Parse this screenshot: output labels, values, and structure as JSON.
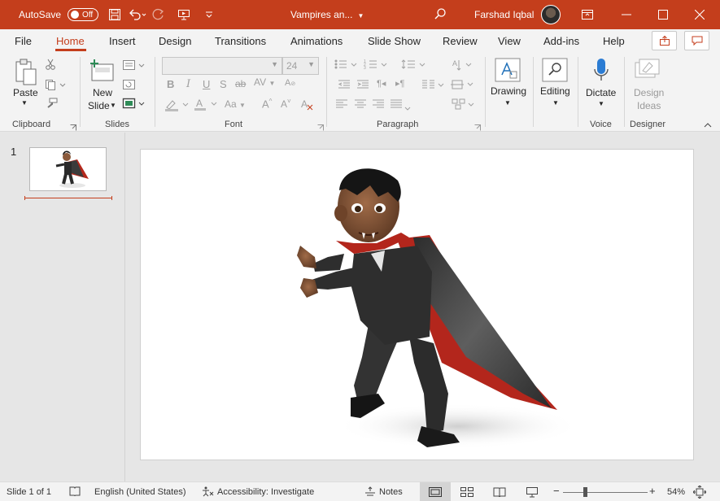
{
  "titlebar": {
    "autosave_label": "AutoSave",
    "autosave_state": "Off",
    "document_title": "Vampires an...",
    "user_name": "Farshad Iqbal"
  },
  "tabs": [
    "File",
    "Home",
    "Insert",
    "Design",
    "Transitions",
    "Animations",
    "Slide Show",
    "Review",
    "View",
    "Add-ins",
    "Help"
  ],
  "active_tab": "Home",
  "ribbon": {
    "clipboard": {
      "label": "Clipboard",
      "paste": "Paste"
    },
    "slides": {
      "label": "Slides",
      "new_slide_1": "New",
      "new_slide_2": "Slide"
    },
    "font": {
      "label": "Font",
      "font_name": "",
      "font_size": "24"
    },
    "paragraph": {
      "label": "Paragraph"
    },
    "drawing": {
      "label": "Drawing"
    },
    "editing": {
      "label": "Editing"
    },
    "voice": {
      "label": "Voice",
      "dictate": "Dictate"
    },
    "designer": {
      "label": "Designer",
      "ideas_1": "Design",
      "ideas_2": "Ideas"
    }
  },
  "thumbnails": [
    {
      "number": "1"
    }
  ],
  "status": {
    "slide_of": "Slide 1 of 1",
    "language": "English (United States)",
    "accessibility": "Accessibility: Investigate",
    "notes": "Notes",
    "zoom": "54%"
  },
  "colors": {
    "accent": "#c43e1c",
    "ribbon_bg": "#f3f3f3",
    "work_bg": "#e6e6e6"
  }
}
